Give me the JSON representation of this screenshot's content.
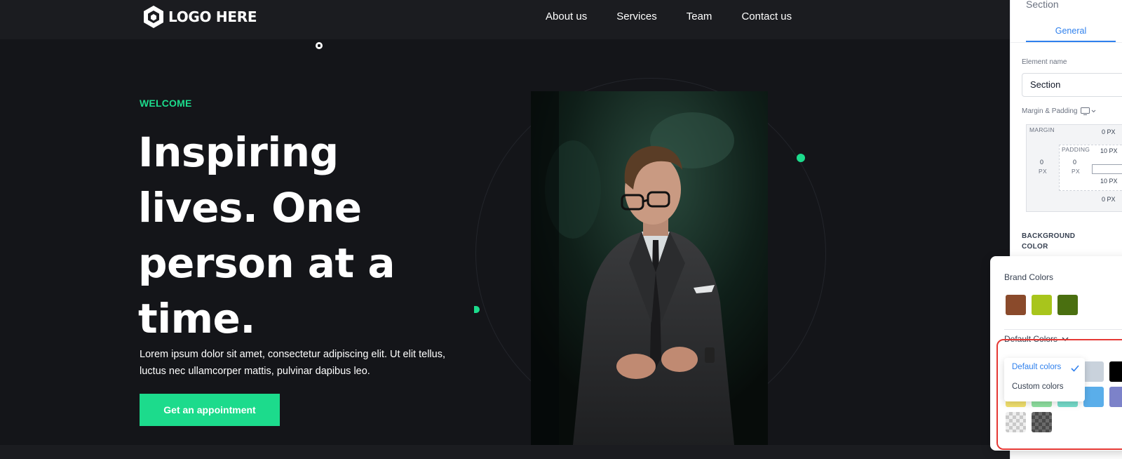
{
  "site": {
    "logo_text": "LOGO HERE",
    "nav": [
      {
        "label": "About us"
      },
      {
        "label": "Services"
      },
      {
        "label": "Team"
      },
      {
        "label": "Contact us"
      }
    ],
    "hero": {
      "eyebrow": "WELCOME",
      "headline_lines": [
        "Inspiring",
        "lives. One",
        "person at a",
        "time."
      ],
      "body": "Lorem ipsum dolor sit amet, consectetur adipiscing elit. Ut elit tellus, luctus nec ullamcorper mattis, pulvinar dapibus leo.",
      "cta_label": "Get an appointment"
    },
    "colors": {
      "background": "#141519",
      "nav_bg": "#1b1c20",
      "accent": "#1cdb8c",
      "text": "#ffffff"
    }
  },
  "panel": {
    "title": "Section",
    "tab": "General",
    "element_name_label": "Element name",
    "element_name_value": "Section",
    "margin_padding_label": "Margin & Padding",
    "margin_label": "MARGIN",
    "padding_label": "PADDING",
    "margin": {
      "top": "0 PX",
      "left_num": "0",
      "left_unit": "PX",
      "bottom": "0 PX"
    },
    "padding": {
      "top": "10 PX",
      "left_num": "0",
      "left_unit": "PX",
      "bottom": "10 PX"
    },
    "background_label_1": "BACKGROUND",
    "background_label_2": "COLOR",
    "accent": "#2f80ed"
  },
  "picker": {
    "brand_title": "Brand Colors",
    "brand_colors": [
      "#8a4a2b",
      "#a8c51c",
      "#4a6f10"
    ],
    "default_title": "Default Colors",
    "dropdown_options": [
      {
        "label": "Default colors",
        "selected": true
      },
      {
        "label": "Custom colors",
        "selected": false
      }
    ],
    "default_colors": [
      "#c9d2dc",
      "#000000",
      "#f2e06e",
      "#8fe0a0",
      "#76dccb",
      "#5aaeea",
      "#7c82c9",
      "transparent",
      "transparent-dark"
    ],
    "highlight_color": "#e53935"
  }
}
